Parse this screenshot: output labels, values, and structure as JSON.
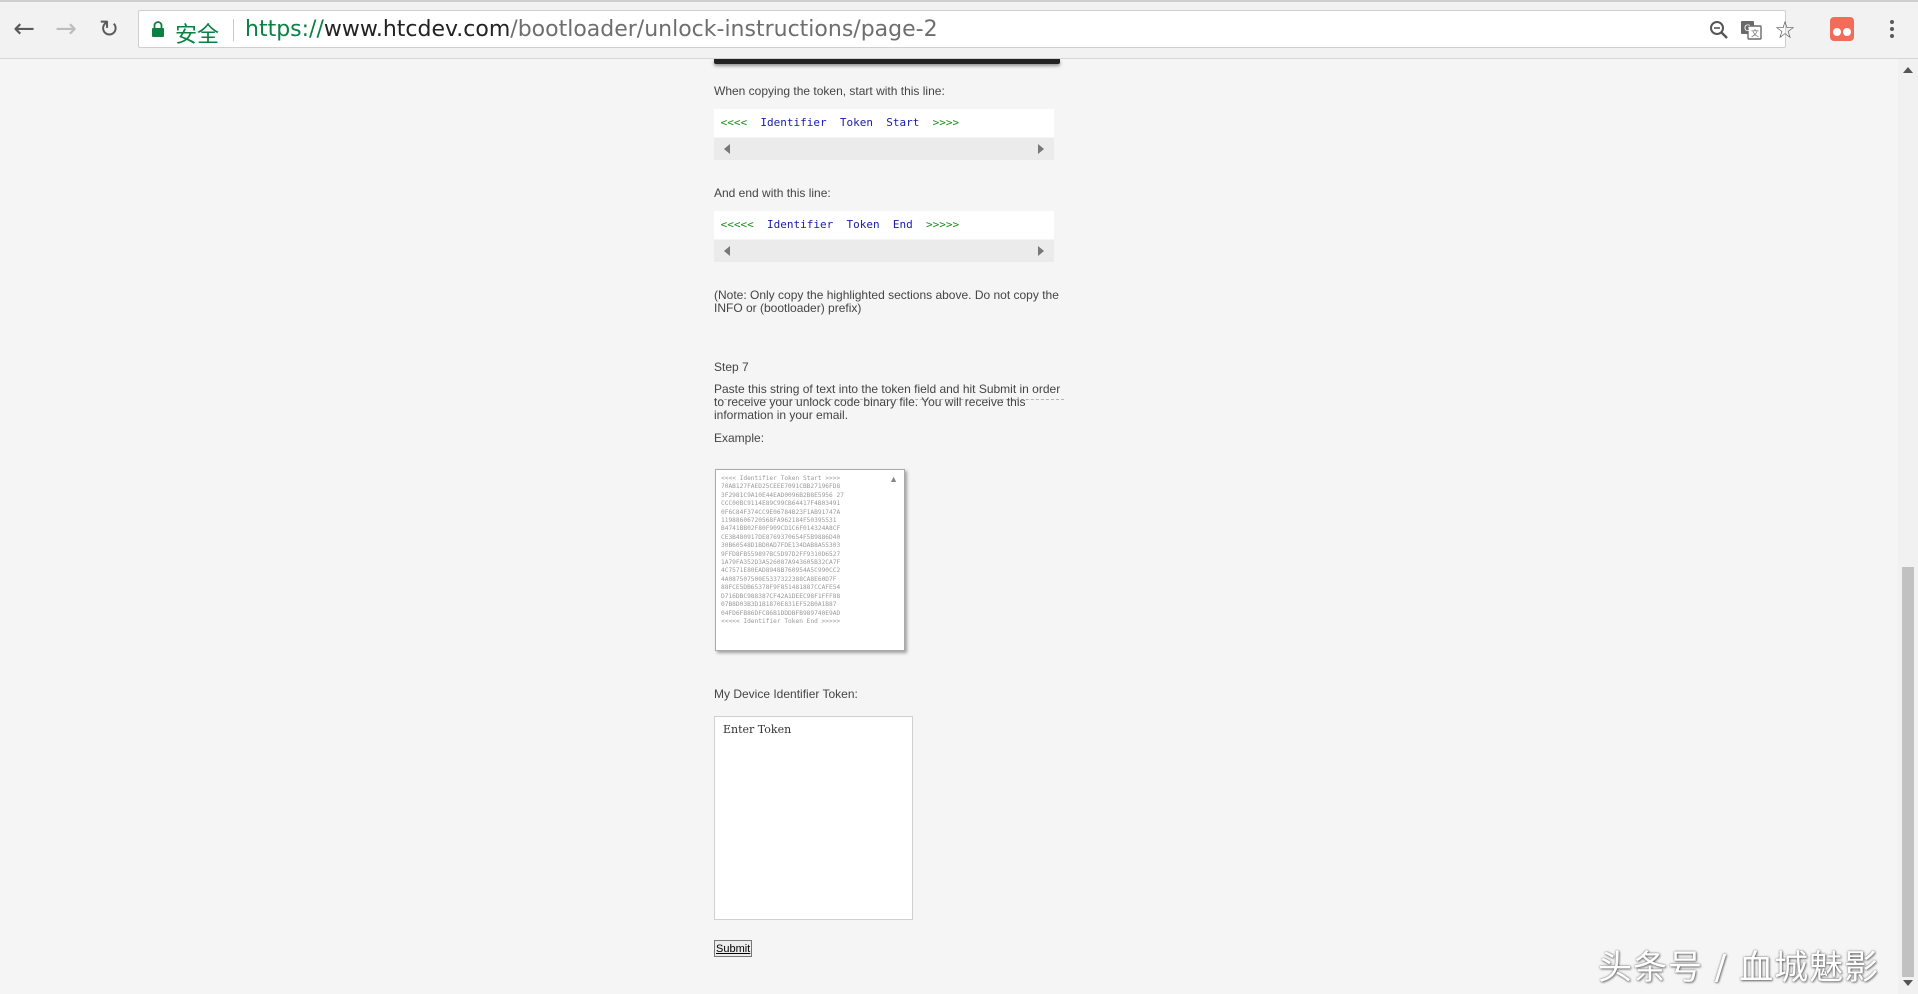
{
  "browser": {
    "secure_label": "安全",
    "url_scheme": "https://",
    "url_host": "www.htcdev.com",
    "url_path": "/bootloader/unlock-instructions/page-2"
  },
  "content": {
    "copy_start_text": "When copying the token, start with this line:",
    "start_line": {
      "open": "<<<<",
      "words": [
        "Identifier",
        "Token",
        "Start"
      ],
      "close": ">>>>"
    },
    "copy_end_text": "And end with this line:",
    "end_line": {
      "open": "<<<<<",
      "words": [
        "Identifier",
        "Token",
        "End"
      ],
      "close": ">>>>>"
    },
    "note": "(Note: Only copy the highlighted sections above. Do not copy the INFO or (bootloader) prefix)",
    "step_title": "Step 7",
    "step_desc": "Paste this string of text into the token field and hit Submit in order to receive your unlock code binary file. You will receive this information in your email.",
    "example_label": "Example:",
    "example_token": "<<<< Identifier Token Start >>>>\n70AB127FAED25CEEE7091CBB27196FD8\n3F2981C9A10E44EAD0096B2B8E5956 27\nCCC00BC9114E89C99CB64417F4B03491\n0F6C84F374CC9E06784B23F1AB91747A\n11988606720568FA962184F50395531\nB4741BB02F80F909CD1C6F014324A8CF\nCE3B480917DE8769370654F5B9886D40\n30B60548D1BD0AD7FDE134DAB8A55303\n9FFD8FB559897BC5D97D2FF9310D6527\n1A79FA352D3A526087A943605B32CA7F\n4C7571E80EAD8948B760954A5C990CC2\n4A087507500E5337322388CA8E60D7F\n88FCE5DB65378F9F851481887CCAFE54\nD716DBC988387CF42A1DEEC98F1FFF88\n07B8D03B3D1B1870E831EF52B0A1B87\n04FD6FB86DFC86B1DDDBFB989740E9AD\n<<<<< Identifier Token End >>>>>",
    "device_token_label": "My Device Identifier Token:",
    "token_placeholder": "Enter Token",
    "submit_label": "Submit"
  },
  "watermark": "头条号 / 血城魅影"
}
